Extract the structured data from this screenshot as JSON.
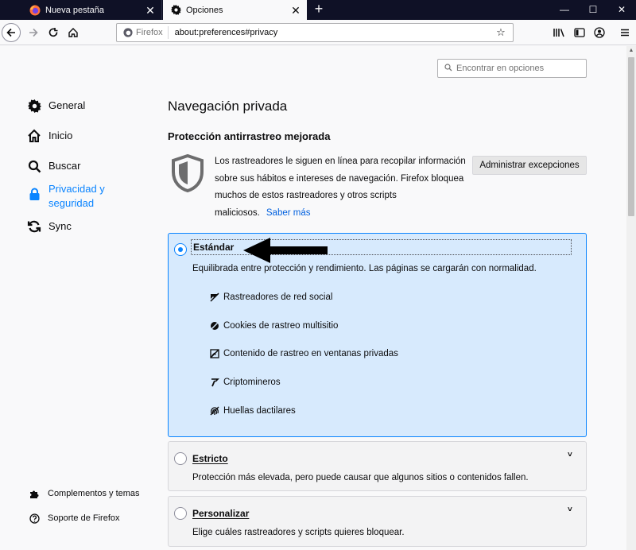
{
  "tabs": [
    {
      "title": "Nueva pestaña",
      "close": "✕"
    },
    {
      "title": "Opciones",
      "close": "✕"
    }
  ],
  "new_tab": "+",
  "window_controls": {
    "minimize": "—",
    "maximize": "☐",
    "close": "✕"
  },
  "urlbar": {
    "identity_label": "Firefox",
    "url": "about:preferences#privacy",
    "bookmark_star": "☆"
  },
  "search": {
    "placeholder": "Encontrar en opciones"
  },
  "sidebar": {
    "items": [
      {
        "label": "General",
        "icon": "gear-icon"
      },
      {
        "label": "Inicio",
        "icon": "home-icon"
      },
      {
        "label": "Buscar",
        "icon": "search-icon"
      },
      {
        "label": "Privacidad y seguridad",
        "icon": "lock-icon",
        "selected": true
      },
      {
        "label": "Sync",
        "icon": "sync-icon"
      }
    ],
    "footer": [
      {
        "label": "Complementos y temas",
        "icon": "puzzle-icon"
      },
      {
        "label": "Soporte de Firefox",
        "icon": "help-icon"
      }
    ]
  },
  "main": {
    "title": "Navegación privada",
    "section_title": "Protección antirrastreo mejorada",
    "description": "Los rastreadores le siguen en línea para recopilar información sobre sus hábitos e intereses de navegación. Firefox bloquea muchos de estos rastreadores y otros scripts maliciosos.",
    "learn_more": "Saber más",
    "exceptions_button": "Administrar excepciones",
    "options": [
      {
        "label": "Estándar",
        "description": "Equilibrada entre protección y rendimiento. Las páginas se cargarán con normalidad.",
        "selected": true,
        "trackers": [
          {
            "label": "Rastreadores de red social",
            "icon": "social-tracker-icon"
          },
          {
            "label": "Cookies de rastreo multisitio",
            "icon": "cookie-icon"
          },
          {
            "label": "Contenido de rastreo en ventanas privadas",
            "icon": "tracking-content-icon"
          },
          {
            "label": "Criptomineros",
            "icon": "cryptominer-icon"
          },
          {
            "label": "Huellas dactilares",
            "icon": "fingerprint-icon"
          }
        ]
      },
      {
        "label": "Estricto",
        "description": "Protección más elevada, pero puede causar que algunos sitios o contenidos fallen.",
        "selected": false
      },
      {
        "label": "Personalizar",
        "description": "Elige cuáles rastreadores y scripts quieres bloquear.",
        "selected": false
      }
    ]
  },
  "colors": {
    "accent": "#0a84ff",
    "selected_bg": "#d7eafd",
    "tabbar_bg": "#0f1126",
    "link": "#0060df"
  }
}
